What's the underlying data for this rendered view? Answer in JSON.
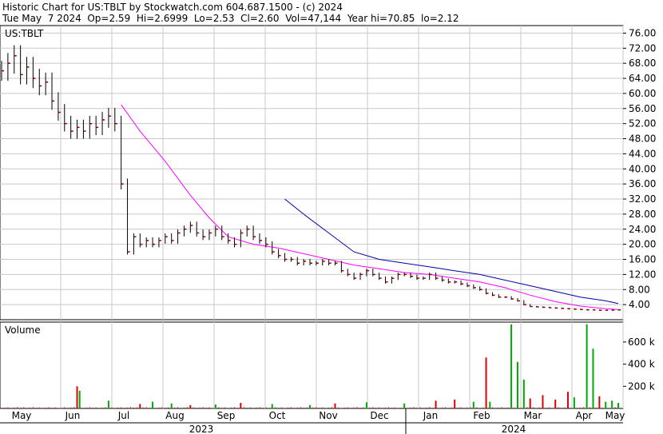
{
  "header": {
    "line1": "Historic Chart for US:TBLT by Stockwatch.com 604.687.1500 - (c) 2024",
    "line2": "Tue May  7 2024  Op=2.59  Hi=2.6999  Lo=2.53  Cl=2.60  Vol=47,144  Year hi=70.85  lo=2.12"
  },
  "chart_data": [
    {
      "type": "ohlc",
      "title": "US:TBLT",
      "ylim": [
        0,
        78
      ],
      "yticks": [
        "76.00",
        "72.00",
        "68.00",
        "64.00",
        "60.00",
        "56.00",
        "52.00",
        "48.00",
        "44.00",
        "40.00",
        "36.00",
        "32.00",
        "28.00",
        "24.00",
        "20.00",
        "16.00",
        "12.00",
        "8.00",
        "4.00"
      ],
      "grid": true,
      "colors": {
        "bar": "#8b0000",
        "ma_short": "#ff00ff",
        "ma_long": "#0000aa",
        "grid": "#c8c8c8"
      },
      "x_months": [
        "May",
        "Jun",
        "Jul",
        "Aug",
        "Sep",
        "Oct",
        "Nov",
        "Dec",
        "Jan",
        "Feb",
        "Mar",
        "Apr",
        "May"
      ],
      "x_years": [
        "2023",
        "2024"
      ],
      "series": [
        {
          "kind": "close",
          "points": [
            [
              0,
              66
            ],
            [
              1,
              68
            ],
            [
              2,
              70
            ],
            [
              3,
              65
            ],
            [
              4,
              67
            ],
            [
              5,
              64
            ],
            [
              6,
              62
            ],
            [
              7,
              63
            ],
            [
              8,
              58
            ],
            [
              9,
              55
            ],
            [
              10,
              52
            ],
            [
              11,
              50
            ],
            [
              12,
              51
            ],
            [
              13,
              50
            ],
            [
              14,
              52
            ],
            [
              15,
              51
            ],
            [
              16,
              53
            ],
            [
              17,
              54
            ],
            [
              18,
              52
            ],
            [
              19,
              36
            ],
            [
              20,
              18
            ],
            [
              21,
              22
            ],
            [
              22,
              20
            ],
            [
              23,
              21
            ],
            [
              24,
              20
            ],
            [
              25,
              21
            ],
            [
              26,
              22
            ],
            [
              27,
              21
            ],
            [
              28,
              23
            ],
            [
              29,
              24
            ],
            [
              30,
              25
            ],
            [
              31,
              23
            ],
            [
              32,
              22
            ],
            [
              33,
              23
            ],
            [
              34,
              24
            ],
            [
              35,
              22
            ],
            [
              36,
              21
            ],
            [
              37,
              20
            ],
            [
              38,
              23
            ],
            [
              39,
              24
            ],
            [
              40,
              22
            ],
            [
              41,
              21
            ],
            [
              42,
              20
            ],
            [
              43,
              18
            ],
            [
              44,
              17
            ],
            [
              45,
              16
            ],
            [
              46,
              16
            ],
            [
              47,
              15
            ],
            [
              48,
              15.5
            ],
            [
              49,
              15
            ],
            [
              50,
              15
            ],
            [
              51,
              15.5
            ],
            [
              52,
              15
            ],
            [
              53,
              15
            ],
            [
              54,
              13
            ],
            [
              55,
              12
            ],
            [
              56,
              11
            ],
            [
              57,
              12
            ],
            [
              58,
              13
            ],
            [
              59,
              12
            ],
            [
              60,
              11
            ],
            [
              61,
              10
            ],
            [
              62,
              11
            ],
            [
              63,
              12
            ],
            [
              64,
              12
            ],
            [
              65,
              11.5
            ],
            [
              66,
              11
            ],
            [
              67,
              11
            ],
            [
              68,
              12
            ],
            [
              69,
              11
            ],
            [
              70,
              10.5
            ],
            [
              71,
              10
            ],
            [
              72,
              10
            ],
            [
              73,
              9.5
            ],
            [
              74,
              9
            ],
            [
              75,
              8.5
            ],
            [
              76,
              8
            ],
            [
              77,
              7
            ],
            [
              78,
              6.5
            ],
            [
              79,
              6
            ],
            [
              80,
              6
            ],
            [
              81,
              5.5
            ],
            [
              82,
              5
            ],
            [
              83,
              4
            ],
            [
              84,
              3.5
            ],
            [
              85,
              3.4
            ],
            [
              86,
              3.3
            ],
            [
              87,
              3.2
            ],
            [
              88,
              3.1
            ],
            [
              89,
              3
            ],
            [
              90,
              2.9
            ],
            [
              91,
              2.8
            ],
            [
              92,
              2.7
            ],
            [
              93,
              2.6
            ],
            [
              94,
              2.6
            ],
            [
              95,
              2.5
            ],
            [
              96,
              2.5
            ],
            [
              97,
              2.55
            ],
            [
              98,
              2.6
            ]
          ],
          "n": 98
        },
        {
          "kind": "ma_short",
          "points": [
            [
              19,
              57
            ],
            [
              22,
              50
            ],
            [
              26,
              42
            ],
            [
              30,
              33
            ],
            [
              33,
              27
            ],
            [
              36,
              22
            ],
            [
              40,
              20
            ],
            [
              44,
              19
            ],
            [
              48,
              17.5
            ],
            [
              52,
              16
            ],
            [
              56,
              14.5
            ],
            [
              60,
              13.5
            ],
            [
              64,
              12.5
            ],
            [
              68,
              12
            ],
            [
              72,
              11
            ],
            [
              76,
              10
            ],
            [
              80,
              8.5
            ],
            [
              84,
              6.5
            ],
            [
              88,
              4.8
            ],
            [
              92,
              3.6
            ],
            [
              96,
              2.9
            ],
            [
              98,
              2.7
            ]
          ]
        },
        {
          "kind": "ma_long",
          "points": [
            [
              45,
              32
            ],
            [
              48,
              28
            ],
            [
              52,
              23
            ],
            [
              56,
              18
            ],
            [
              60,
              16
            ],
            [
              64,
              15
            ],
            [
              68,
              14
            ],
            [
              72,
              13
            ],
            [
              76,
              12
            ],
            [
              80,
              10.5
            ],
            [
              84,
              9
            ],
            [
              88,
              7.5
            ],
            [
              92,
              6
            ],
            [
              96,
              5
            ],
            [
              98,
              4.3
            ]
          ]
        }
      ]
    },
    {
      "type": "bar",
      "title": "Volume",
      "ylim": [
        0,
        780
      ],
      "yticks": [
        "600 k",
        "400 k",
        "200 k"
      ],
      "colors": {
        "up": "#00aa00",
        "down": "#dd0000"
      },
      "values": [
        {
          "x": 12,
          "v": 200,
          "c": "down"
        },
        {
          "x": 12.4,
          "v": 160,
          "c": "up"
        },
        {
          "x": 17,
          "v": 70,
          "c": "up"
        },
        {
          "x": 22,
          "v": 40,
          "c": "down"
        },
        {
          "x": 24,
          "v": 60,
          "c": "up"
        },
        {
          "x": 27,
          "v": 45,
          "c": "up"
        },
        {
          "x": 30,
          "v": 30,
          "c": "down"
        },
        {
          "x": 34,
          "v": 35,
          "c": "up"
        },
        {
          "x": 38,
          "v": 50,
          "c": "down"
        },
        {
          "x": 43,
          "v": 40,
          "c": "up"
        },
        {
          "x": 49,
          "v": 30,
          "c": "up"
        },
        {
          "x": 53,
          "v": 45,
          "c": "down"
        },
        {
          "x": 58,
          "v": 55,
          "c": "up"
        },
        {
          "x": 64,
          "v": 45,
          "c": "up"
        },
        {
          "x": 69,
          "v": 70,
          "c": "down"
        },
        {
          "x": 72,
          "v": 80,
          "c": "down"
        },
        {
          "x": 75,
          "v": 60,
          "c": "up"
        },
        {
          "x": 77,
          "v": 460,
          "c": "down"
        },
        {
          "x": 77.6,
          "v": 60,
          "c": "up"
        },
        {
          "x": 81,
          "v": 760,
          "c": "up"
        },
        {
          "x": 82,
          "v": 420,
          "c": "up"
        },
        {
          "x": 83,
          "v": 260,
          "c": "up"
        },
        {
          "x": 84,
          "v": 90,
          "c": "down"
        },
        {
          "x": 86,
          "v": 120,
          "c": "down"
        },
        {
          "x": 88,
          "v": 80,
          "c": "down"
        },
        {
          "x": 90,
          "v": 150,
          "c": "down"
        },
        {
          "x": 91,
          "v": 100,
          "c": "up"
        },
        {
          "x": 93,
          "v": 760,
          "c": "up"
        },
        {
          "x": 94,
          "v": 540,
          "c": "up"
        },
        {
          "x": 95,
          "v": 110,
          "c": "down"
        },
        {
          "x": 96,
          "v": 60,
          "c": "up"
        },
        {
          "x": 97,
          "v": 70,
          "c": "up"
        },
        {
          "x": 98,
          "v": 50,
          "c": "up"
        }
      ]
    }
  ]
}
